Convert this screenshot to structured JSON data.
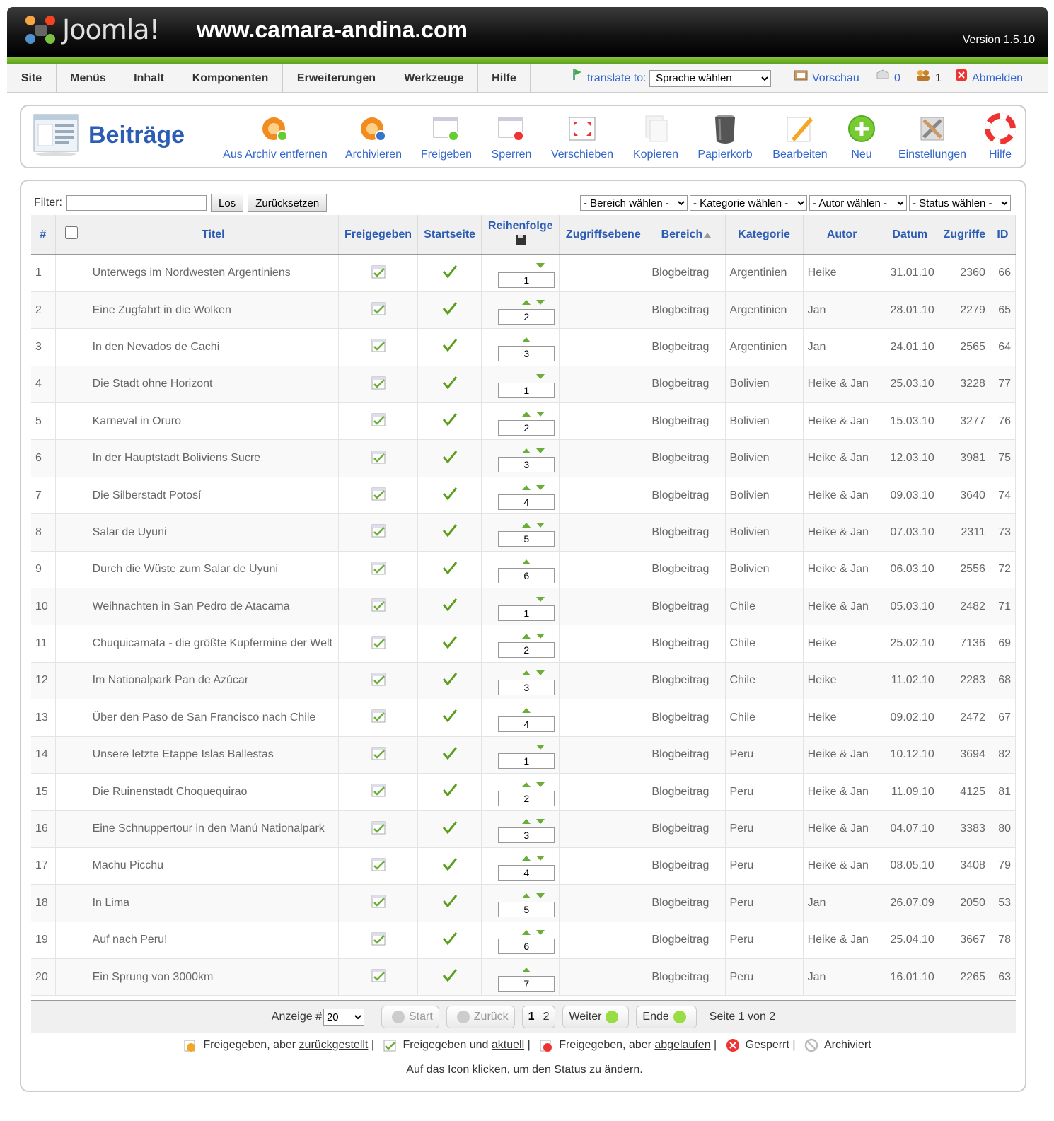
{
  "header": {
    "logo_text": "Joomla!",
    "site_url": "www.camara-andina.com",
    "version": "Version 1.5.10"
  },
  "menu": {
    "items": [
      "Site",
      "Menüs",
      "Inhalt",
      "Komponenten",
      "Erweiterungen",
      "Werkzeuge",
      "Hilfe"
    ],
    "translate_label": "translate to:",
    "language_select": "Sprache wählen",
    "preview": "Vorschau",
    "messages_count": "0",
    "users_count": "1",
    "logout": "Abmelden"
  },
  "toolbar": {
    "title": "Beiträge",
    "buttons": [
      {
        "label": "Aus Archiv entfernen",
        "icon": "unarchive-icon"
      },
      {
        "label": "Archivieren",
        "icon": "archive-icon"
      },
      {
        "label": "Freigeben",
        "icon": "publish-icon"
      },
      {
        "label": "Sperren",
        "icon": "unpublish-icon"
      },
      {
        "label": "Verschieben",
        "icon": "move-icon"
      },
      {
        "label": "Kopieren",
        "icon": "copy-icon"
      },
      {
        "label": "Papierkorb",
        "icon": "trash-icon"
      },
      {
        "label": "Bearbeiten",
        "icon": "edit-icon"
      },
      {
        "label": "Neu",
        "icon": "new-icon"
      },
      {
        "label": "Einstellungen",
        "icon": "settings-icon"
      },
      {
        "label": "Hilfe",
        "icon": "help-icon"
      }
    ]
  },
  "filter": {
    "label": "Filter:",
    "value": "",
    "go": "Los",
    "reset": "Zurücksetzen",
    "section": "- Bereich wählen -",
    "category": "- Kategorie wählen -",
    "author": "- Autor wählen -",
    "state": "- Status wählen -"
  },
  "table": {
    "headers": {
      "num": "#",
      "title": "Titel",
      "published": "Freigegeben",
      "frontpage": "Startseite",
      "order": "Reihenfolge",
      "access": "Zugriffsebene",
      "section": "Bereich",
      "category": "Kategorie",
      "author": "Autor",
      "date": "Datum",
      "hits": "Zugriffe",
      "id": "ID"
    },
    "rows": [
      {
        "n": "1",
        "title": "Unterwegs im Nordwesten Argentiniens",
        "up": false,
        "down": true,
        "order": "1",
        "section": "Blogbeitrag",
        "category": "Argentinien",
        "author": "Heike",
        "date": "31.01.10",
        "hits": "2360",
        "id": "66"
      },
      {
        "n": "2",
        "title": "Eine Zugfahrt in die Wolken",
        "up": true,
        "down": true,
        "order": "2",
        "section": "Blogbeitrag",
        "category": "Argentinien",
        "author": "Jan",
        "date": "28.01.10",
        "hits": "2279",
        "id": "65"
      },
      {
        "n": "3",
        "title": "In den Nevados de Cachi",
        "up": true,
        "down": false,
        "order": "3",
        "section": "Blogbeitrag",
        "category": "Argentinien",
        "author": "Jan",
        "date": "24.01.10",
        "hits": "2565",
        "id": "64"
      },
      {
        "n": "4",
        "title": "Die Stadt ohne Horizont",
        "up": false,
        "down": true,
        "order": "1",
        "section": "Blogbeitrag",
        "category": "Bolivien",
        "author": "Heike & Jan",
        "date": "25.03.10",
        "hits": "3228",
        "id": "77"
      },
      {
        "n": "5",
        "title": "Karneval in Oruro",
        "up": true,
        "down": true,
        "order": "2",
        "section": "Blogbeitrag",
        "category": "Bolivien",
        "author": "Heike & Jan",
        "date": "15.03.10",
        "hits": "3277",
        "id": "76"
      },
      {
        "n": "6",
        "title": "In der Hauptstadt Boliviens Sucre",
        "up": true,
        "down": true,
        "order": "3",
        "section": "Blogbeitrag",
        "category": "Bolivien",
        "author": "Heike & Jan",
        "date": "12.03.10",
        "hits": "3981",
        "id": "75"
      },
      {
        "n": "7",
        "title": "Die Silberstadt Potosí",
        "up": true,
        "down": true,
        "order": "4",
        "section": "Blogbeitrag",
        "category": "Bolivien",
        "author": "Heike & Jan",
        "date": "09.03.10",
        "hits": "3640",
        "id": "74"
      },
      {
        "n": "8",
        "title": "Salar de Uyuni",
        "up": true,
        "down": true,
        "order": "5",
        "section": "Blogbeitrag",
        "category": "Bolivien",
        "author": "Heike & Jan",
        "date": "07.03.10",
        "hits": "2311",
        "id": "73"
      },
      {
        "n": "9",
        "title": "Durch die Wüste zum Salar de Uyuni",
        "up": true,
        "down": false,
        "order": "6",
        "section": "Blogbeitrag",
        "category": "Bolivien",
        "author": "Heike & Jan",
        "date": "06.03.10",
        "hits": "2556",
        "id": "72"
      },
      {
        "n": "10",
        "title": "Weihnachten in San Pedro de Atacama",
        "up": false,
        "down": true,
        "order": "1",
        "section": "Blogbeitrag",
        "category": "Chile",
        "author": "Heike & Jan",
        "date": "05.03.10",
        "hits": "2482",
        "id": "71"
      },
      {
        "n": "11",
        "title": "Chuquicamata - die größte Kupfermine der Welt",
        "up": true,
        "down": true,
        "order": "2",
        "section": "Blogbeitrag",
        "category": "Chile",
        "author": "Heike",
        "date": "25.02.10",
        "hits": "7136",
        "id": "69"
      },
      {
        "n": "12",
        "title": "Im Nationalpark Pan de Azúcar",
        "up": true,
        "down": true,
        "order": "3",
        "section": "Blogbeitrag",
        "category": "Chile",
        "author": "Heike",
        "date": "11.02.10",
        "hits": "2283",
        "id": "68"
      },
      {
        "n": "13",
        "title": "Über den Paso de San Francisco nach Chile",
        "up": true,
        "down": false,
        "order": "4",
        "section": "Blogbeitrag",
        "category": "Chile",
        "author": "Heike",
        "date": "09.02.10",
        "hits": "2472",
        "id": "67"
      },
      {
        "n": "14",
        "title": "Unsere letzte Etappe Islas Ballestas",
        "up": false,
        "down": true,
        "order": "1",
        "section": "Blogbeitrag",
        "category": "Peru",
        "author": "Heike & Jan",
        "date": "10.12.10",
        "hits": "3694",
        "id": "82"
      },
      {
        "n": "15",
        "title": "Die Ruinenstadt Choquequirao",
        "up": true,
        "down": true,
        "order": "2",
        "section": "Blogbeitrag",
        "category": "Peru",
        "author": "Heike & Jan",
        "date": "11.09.10",
        "hits": "4125",
        "id": "81"
      },
      {
        "n": "16",
        "title": "Eine Schnuppertour in den Manú Nationalpark",
        "up": true,
        "down": true,
        "order": "3",
        "section": "Blogbeitrag",
        "category": "Peru",
        "author": "Heike & Jan",
        "date": "04.07.10",
        "hits": "3383",
        "id": "80"
      },
      {
        "n": "17",
        "title": "Machu Picchu",
        "up": true,
        "down": true,
        "order": "4",
        "section": "Blogbeitrag",
        "category": "Peru",
        "author": "Heike & Jan",
        "date": "08.05.10",
        "hits": "3408",
        "id": "79"
      },
      {
        "n": "18",
        "title": "In Lima",
        "up": true,
        "down": true,
        "order": "5",
        "section": "Blogbeitrag",
        "category": "Peru",
        "author": "Jan",
        "date": "26.07.09",
        "hits": "2050",
        "id": "53"
      },
      {
        "n": "19",
        "title": "Auf nach Peru!",
        "up": true,
        "down": true,
        "order": "6",
        "section": "Blogbeitrag",
        "category": "Peru",
        "author": "Heike & Jan",
        "date": "25.04.10",
        "hits": "3667",
        "id": "78"
      },
      {
        "n": "20",
        "title": "Ein Sprung von 3000km",
        "up": true,
        "down": false,
        "order": "7",
        "section": "Blogbeitrag",
        "category": "Peru",
        "author": "Jan",
        "date": "16.01.10",
        "hits": "2265",
        "id": "63"
      }
    ]
  },
  "pagination": {
    "display_label": "Anzeige #",
    "limit": "20",
    "start": "Start",
    "prev": "Zurück",
    "page1": "1",
    "page2": "2",
    "next": "Weiter",
    "end": "Ende",
    "page_info": "Seite 1 von 2"
  },
  "legend": {
    "pending_a": "Freigegeben, aber ",
    "pending_b": "zurückgestellt",
    "current_a": "Freigegeben und ",
    "current_b": "aktuell",
    "expired_a": "Freigegeben, aber ",
    "expired_b": "abgelaufen",
    "unpublished": "Gesperrt",
    "archived": "Archiviert",
    "sep": "|",
    "hint": "Auf das Icon klicken, um den Status zu ändern."
  },
  "colors": {
    "accent": "#2c5cb4",
    "link": "#3366cc",
    "header_green": "#8cc63f",
    "arrow_green": "#6aad38"
  }
}
